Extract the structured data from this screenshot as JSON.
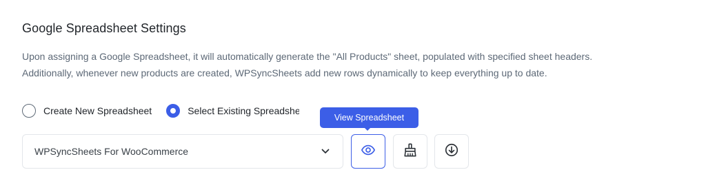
{
  "section": {
    "title": "Google Spreadsheet Settings",
    "description_line1": "Upon assigning a Google Spreadsheet, it will automatically generate the \"All Products\" sheet, populated with specified sheet headers.",
    "description_line2": "Additionally, whenever new products are created, WPSyncSheets add new rows dynamically to keep everything up to date."
  },
  "spreadsheet_mode": {
    "options": [
      {
        "label": "Create New Spreadsheet",
        "checked": false
      },
      {
        "label": "Select Existing Spreadsheet",
        "checked": true
      }
    ]
  },
  "spreadsheet_select": {
    "value": "WPSyncSheets For WooCommerce"
  },
  "actions": {
    "view_tooltip": "View Spreadsheet",
    "view_icon": "eye-icon",
    "clear_icon": "broom-icon",
    "download_icon": "download-icon"
  },
  "colors": {
    "accent": "#3c5ee7",
    "text_primary": "#1f2328",
    "text_muted": "#5c6876",
    "border": "#e3e6ea"
  }
}
